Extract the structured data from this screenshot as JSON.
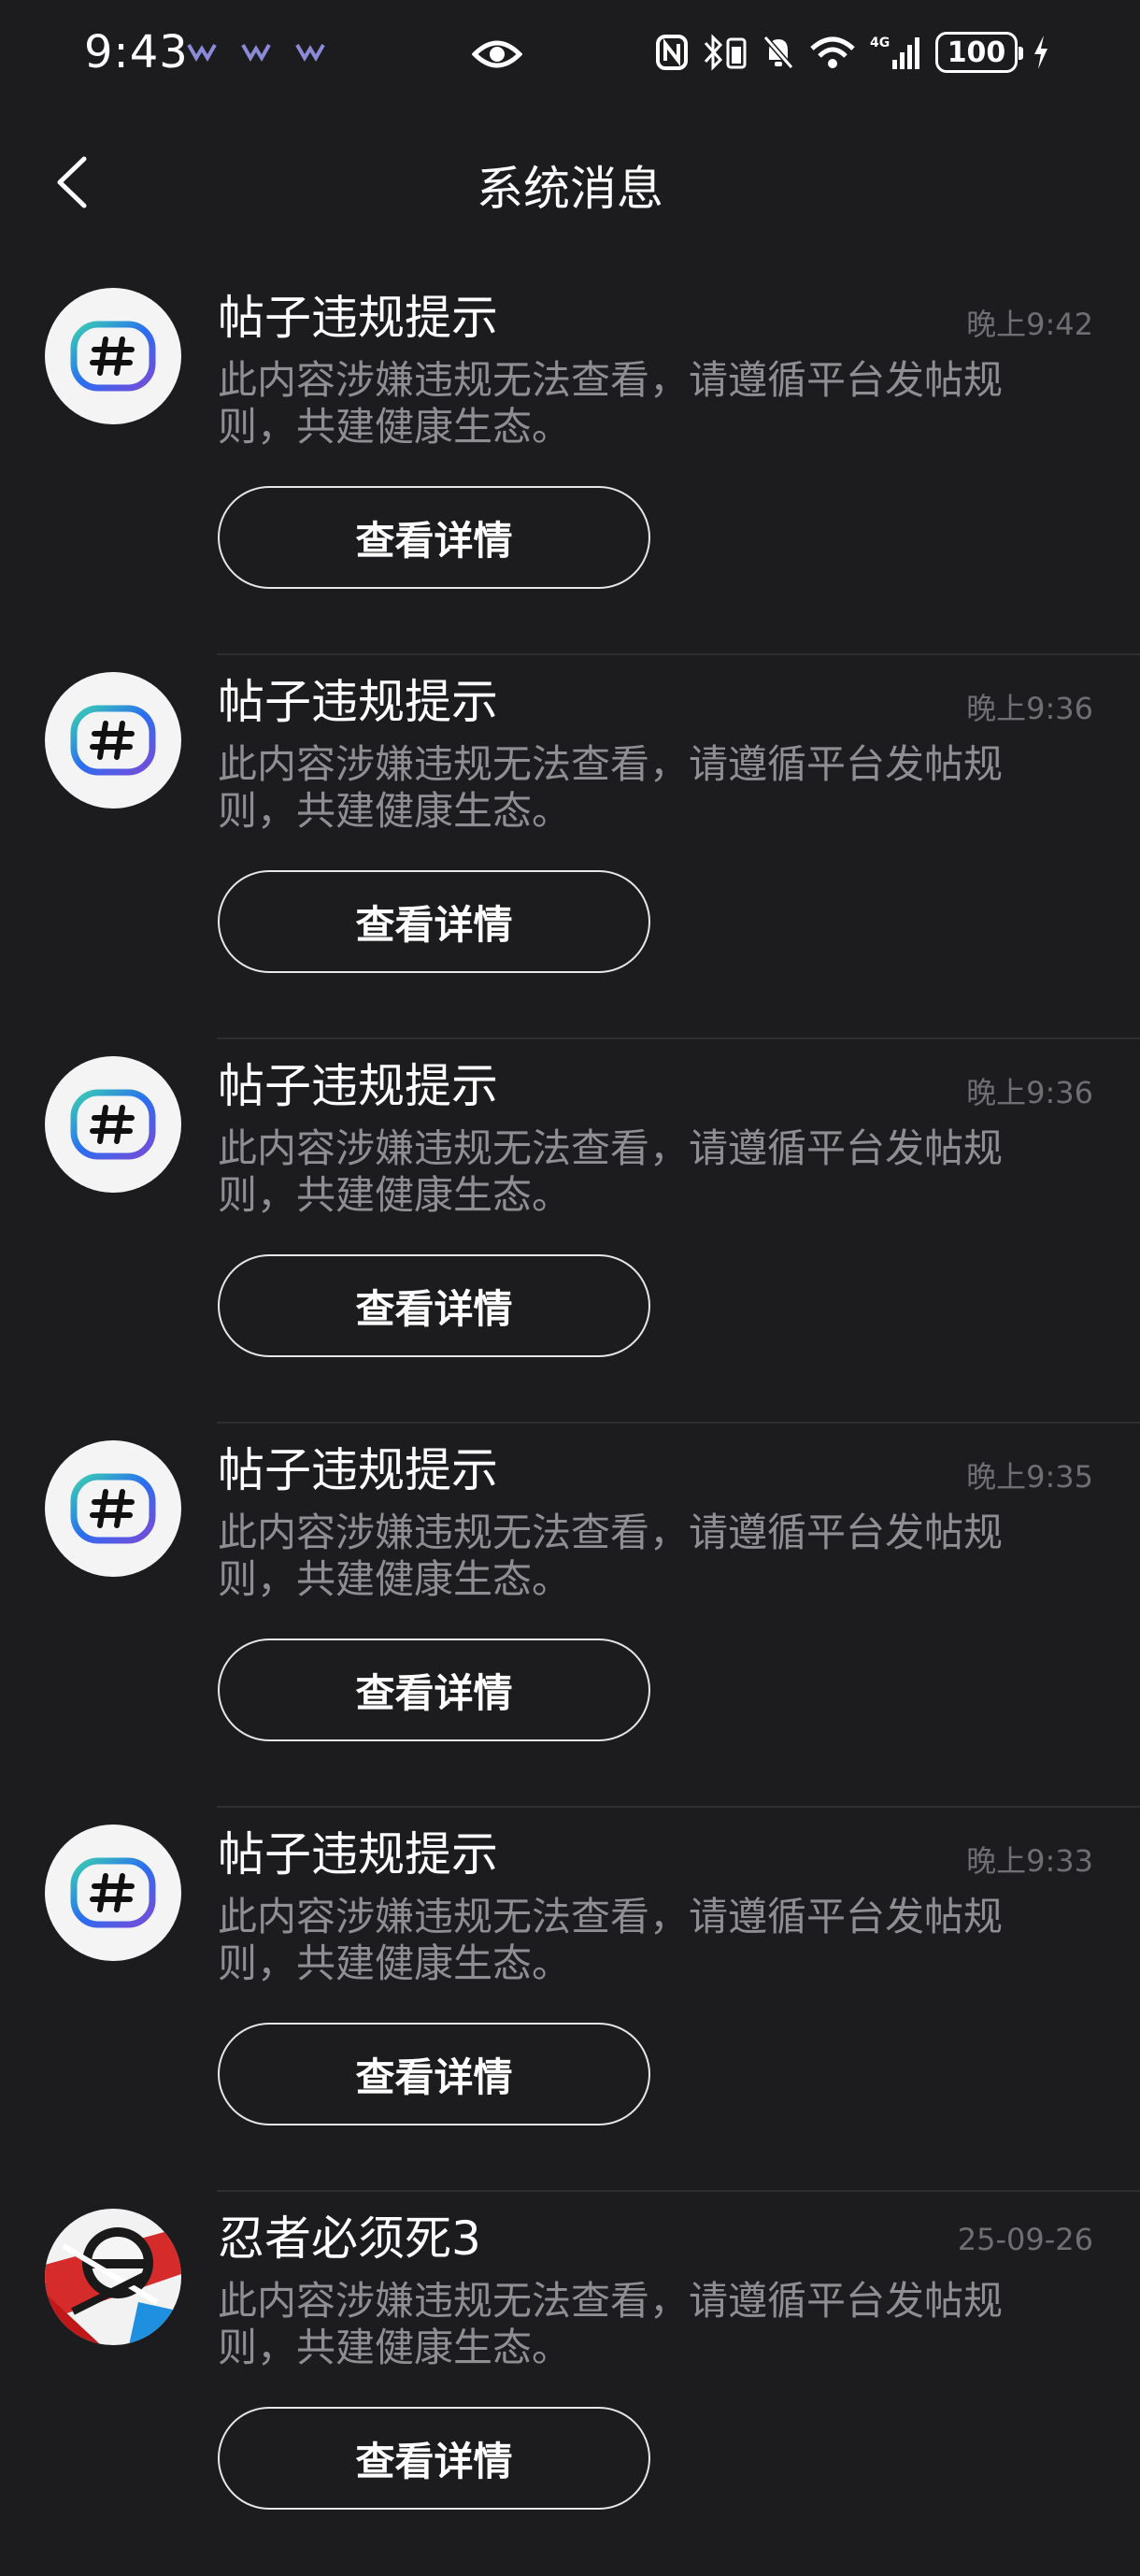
{
  "status_bar": {
    "time": "9:43",
    "battery": "100",
    "network": "4G"
  },
  "nav": {
    "title": "系统消息"
  },
  "messages": [
    {
      "title": "帖子违规提示",
      "time": "晚上9:42",
      "body": "此内容涉嫌违规无法查看，请遵循平台发帖规则，共建健康生态。",
      "button": "查看详情",
      "avatar": "hashtag-icon"
    },
    {
      "title": "帖子违规提示",
      "time": "晚上9:36",
      "body": "此内容涉嫌违规无法查看，请遵循平台发帖规则，共建健康生态。",
      "button": "查看详情",
      "avatar": "hashtag-icon"
    },
    {
      "title": "帖子违规提示",
      "time": "晚上9:36",
      "body": "此内容涉嫌违规无法查看，请遵循平台发帖规则，共建健康生态。",
      "button": "查看详情",
      "avatar": "hashtag-icon"
    },
    {
      "title": "帖子违规提示",
      "time": "晚上9:35",
      "body": "此内容涉嫌违规无法查看，请遵循平台发帖规则，共建健康生态。",
      "button": "查看详情",
      "avatar": "hashtag-icon"
    },
    {
      "title": "帖子违规提示",
      "time": "晚上9:33",
      "body": "此内容涉嫌违规无法查看，请遵循平台发帖规则，共建健康生态。",
      "button": "查看详情",
      "avatar": "hashtag-icon"
    },
    {
      "title": "忍者必须死3",
      "time": "25-09-26",
      "body": "此内容涉嫌违规无法查看，请遵循平台发帖规则，共建健康生态。",
      "button": "查看详情",
      "avatar": "game-avatar"
    }
  ]
}
